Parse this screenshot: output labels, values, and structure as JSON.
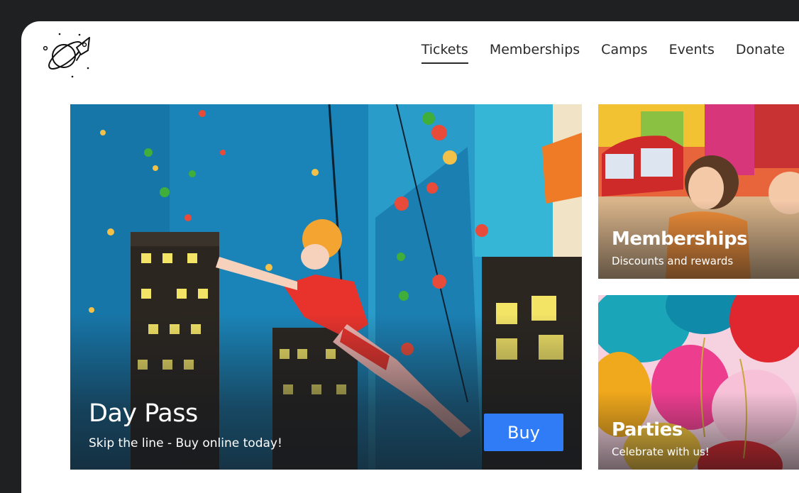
{
  "header": {
    "logo_icon": "planet-rocket-icon",
    "nav": [
      {
        "label": "Tickets",
        "active": true
      },
      {
        "label": "Memberships"
      },
      {
        "label": "Camps"
      },
      {
        "label": "Events"
      },
      {
        "label": "Donate"
      }
    ]
  },
  "hero": {
    "title": "Day Pass",
    "subtitle": "Skip the line - Buy online today!",
    "button_label": "Buy",
    "button_color": "#2f7cf6",
    "image": "child-climbing-wall-photo"
  },
  "cards": [
    {
      "title": "Memberships",
      "subtitle": "Discounts and rewards",
      "image": "kids-play-area-photo"
    },
    {
      "title": "Parties",
      "subtitle": "Celebrate with us!",
      "image": "balloons-photo"
    }
  ]
}
